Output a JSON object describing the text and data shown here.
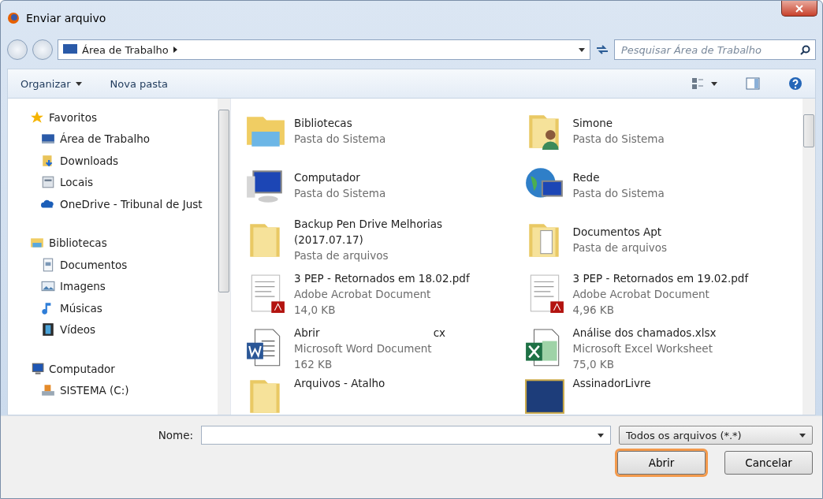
{
  "window": {
    "title": "Enviar arquivo"
  },
  "address": {
    "breadcrumb": "Área de Trabalho",
    "search_placeholder": "Pesquisar Área de Trabalho"
  },
  "toolbar": {
    "organize": "Organizar",
    "new_folder": "Nova pasta"
  },
  "sidebar": [
    {
      "label": "Favoritos",
      "kind": "favorites",
      "children": [
        {
          "label": "Área de Trabalho",
          "kind": "desktop"
        },
        {
          "label": "Downloads",
          "kind": "downloads"
        },
        {
          "label": "Locais",
          "kind": "places"
        },
        {
          "label": "OneDrive - Tribunal de Just",
          "kind": "onedrive"
        }
      ]
    },
    {
      "label": "Bibliotecas",
      "kind": "libraries",
      "children": [
        {
          "label": "Documentos",
          "kind": "documents"
        },
        {
          "label": "Imagens",
          "kind": "images"
        },
        {
          "label": "Músicas",
          "kind": "music"
        },
        {
          "label": "Vídeos",
          "kind": "videos"
        }
      ]
    },
    {
      "label": "Computador",
      "kind": "computer",
      "children": [
        {
          "label": "SISTEMA (C:)",
          "kind": "drive"
        }
      ]
    }
  ],
  "files": [
    {
      "name": "Bibliotecas",
      "kind": "library",
      "type": "Pasta do Sistema"
    },
    {
      "name": "Simone",
      "kind": "user-folder",
      "type": "Pasta do Sistema"
    },
    {
      "name": "Computador",
      "kind": "computer",
      "type": "Pasta do Sistema"
    },
    {
      "name": "Rede",
      "kind": "network",
      "type": "Pasta do Sistema"
    },
    {
      "name": "Backup Pen Drive Melhorias (2017.07.17)",
      "kind": "folder",
      "type": "Pasta de arquivos"
    },
    {
      "name": "Documentos Apt",
      "kind": "folder-docs",
      "type": "Pasta de arquivos"
    },
    {
      "name": "3 PEP - Retornados em 18.02.pdf",
      "kind": "pdf",
      "type": "Adobe Acrobat Document",
      "size": "14,0 KB"
    },
    {
      "name": "3 PEP - Retornados em 19.02.pdf",
      "kind": "pdf",
      "type": "Adobe Acrobat Document",
      "size": "4,96 KB"
    },
    {
      "name": "Abrir",
      "name_end": "cx",
      "kind": "word",
      "type": "Microsoft Word Document",
      "size": "162 KB"
    },
    {
      "name": "Análise dos chamados.xlsx",
      "kind": "excel",
      "type": "Microsoft Excel Worksheet",
      "size": "75,0 KB"
    },
    {
      "name": "Arquivos - Atalho",
      "kind": "folder",
      "cut": true
    },
    {
      "name": "AssinadorLivre",
      "kind": "app",
      "cut": true
    }
  ],
  "footer": {
    "name_label": "Nome:",
    "file_type": "Todos os arquivos (*.*)",
    "buttons": [
      {
        "label": "Abrir",
        "highlighted": true
      },
      {
        "label": "Cancelar",
        "highlighted": false
      }
    ]
  }
}
